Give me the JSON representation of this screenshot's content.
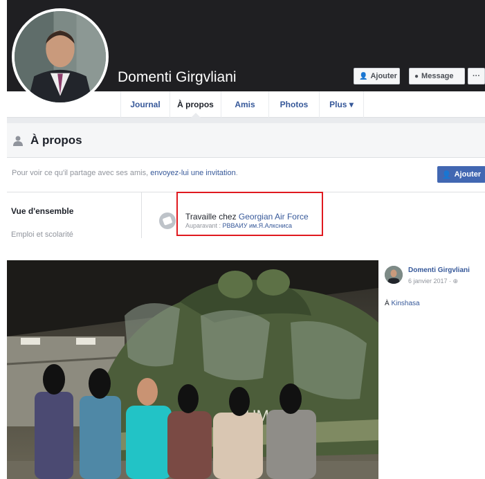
{
  "profile": {
    "name": "Domenti Girgvliani",
    "add_label": "Ajouter",
    "message_label": "Message",
    "more_label": "···"
  },
  "tabs": [
    {
      "label": "Journal"
    },
    {
      "label": "À propos"
    },
    {
      "label": "Amis"
    },
    {
      "label": "Photos"
    },
    {
      "label": "Plus ▾"
    }
  ],
  "about": {
    "title": "À propos",
    "invite_prefix": "Pour voir ce qu'il partage avec ses amis, ",
    "invite_link": "envoyez-lui une invitation",
    "invite_suffix": ".",
    "invite_button": "Ajouter",
    "nav": [
      "Vue d'ensemble",
      "Emploi et scolarité"
    ],
    "work_prefix": "Travaille chez ",
    "work_org": "Georgian Air Force",
    "previous_prefix": "Auparavant : ",
    "previous_org": "РВВАИУ им.Я.Алксниса"
  },
  "post": {
    "author": "Domenti Girgvliani",
    "date": "6 janvier 2017 · ",
    "privacy_icon": "globe-icon",
    "location_prefix": "À ",
    "location": "Kinshasa",
    "aircraft_marking": "ЧНМ 1"
  },
  "colors": {
    "fb_blue": "#4267b2",
    "link_blue": "#365899",
    "highlight_red": "#e0191f",
    "cover_dark": "#1f1f22"
  }
}
